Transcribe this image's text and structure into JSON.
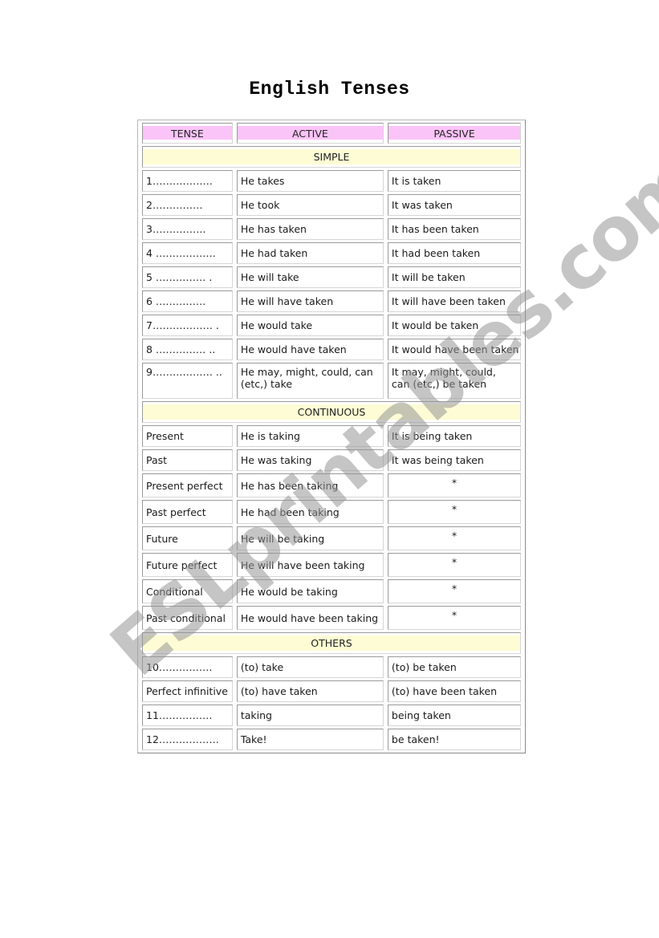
{
  "title": "English Tenses",
  "watermark": "ESLprintables.com",
  "colors": {
    "header_bg": "#fbc4f8",
    "section_bg": "#fdfcd4",
    "watermark": "#969696"
  },
  "table": {
    "headers": [
      "TENSE",
      "ACTIVE",
      "PASSIVE"
    ],
    "sections": [
      {
        "label": "SIMPLE",
        "rows": [
          [
            "1………………",
            "He takes",
            "It is taken"
          ],
          [
            "2……………",
            "He took",
            "It was taken"
          ],
          [
            "3…………….",
            "He has taken",
            "It has been taken"
          ],
          [
            "4 ………………",
            "He had taken",
            "It had been taken"
          ],
          [
            "5 ……………  .",
            "He will take",
            "It will be taken"
          ],
          [
            "6 ……………",
            "He will have taken",
            "It will have been taken"
          ],
          [
            "7……………… .",
            "He would take",
            "It would be taken"
          ],
          [
            "8 …………… ..",
            "He would have taken",
            "It would have been taken"
          ],
          [
            "9……………… ..",
            "He may, might, could, can (etc,) take",
            "It may, might, could, can (etc,) be taken"
          ]
        ]
      },
      {
        "label": "CONTINUOUS",
        "rows": [
          [
            "Present",
            "He is taking",
            "It is being taken"
          ],
          [
            "Past",
            "He was taking",
            "It was being taken"
          ],
          [
            "Present perfect",
            "He has been taking",
            "*"
          ],
          [
            "Past perfect",
            "He had been taking",
            "*"
          ],
          [
            "Future",
            "He will be taking",
            "*"
          ],
          [
            "Future perfect",
            "He will have been taking",
            "*"
          ],
          [
            "Conditional",
            "He would be taking",
            "*"
          ],
          [
            "Past conditional",
            "He would have been taking",
            "*"
          ]
        ]
      },
      {
        "label": "OTHERS",
        "rows": [
          [
            "10…………….",
            "(to) take",
            "(to) be taken"
          ],
          [
            "Perfect infinitive",
            "(to) have taken",
            "(to) have been taken"
          ],
          [
            "11…………….",
            "taking",
            "being taken"
          ],
          [
            "12………………",
            "Take!",
            "be taken!"
          ]
        ]
      }
    ]
  }
}
